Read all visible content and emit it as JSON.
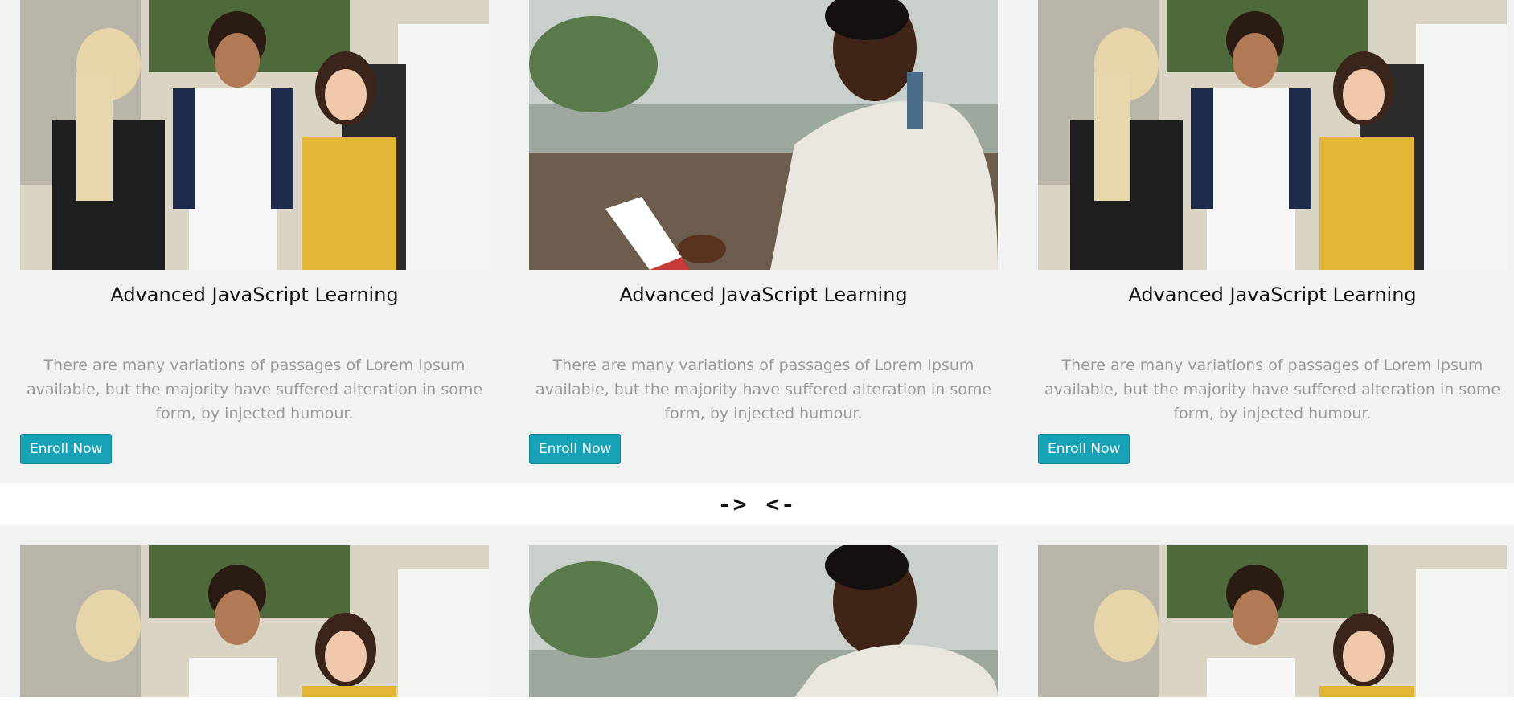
{
  "cards_top": [
    {
      "image_alt": "Students talking outdoors",
      "title": "Advanced JavaScript Learning",
      "text": "There are many variations of passages of Lorem Ipsum available, but the majority have suffered alteration in some form, by injected humour.",
      "button": "Enroll Now"
    },
    {
      "image_alt": "Man reading a book",
      "title": "Advanced JavaScript Learning",
      "text": "There are many variations of passages of Lorem Ipsum available, but the majority have suffered alteration in some form, by injected humour.",
      "button": "Enroll Now"
    },
    {
      "image_alt": "Students talking outdoors",
      "title": "Advanced JavaScript Learning",
      "text": "There are many variations of passages of Lorem Ipsum available, but the majority have suffered alteration in some form, by injected humour.",
      "button": "Enroll Now"
    }
  ],
  "carousel": {
    "next_label": "->",
    "prev_label": "<-"
  },
  "cards_bottom": [
    {
      "image_alt": "Students talking outdoors"
    },
    {
      "image_alt": "Man reading a book"
    },
    {
      "image_alt": "Students talking outdoors"
    }
  ],
  "colors": {
    "card_bg": "#f1f3f2",
    "button_bg": "#17a2b8",
    "text_muted": "#9b9b9b"
  }
}
